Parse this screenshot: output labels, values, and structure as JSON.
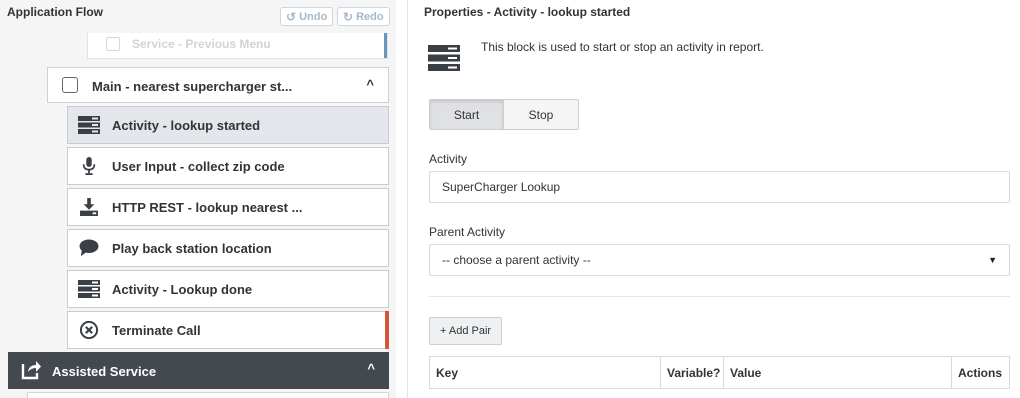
{
  "left_panel": {
    "title": "Application Flow",
    "undo_label": "Undo",
    "redo_label": "Redo",
    "previous_item_label": "Service - Previous Menu",
    "group": {
      "label": "Main - nearest supercharger st..."
    },
    "blocks": [
      {
        "label": "Activity - lookup started",
        "icon": "activity-icon",
        "selected": true
      },
      {
        "label": "User Input - collect zip code",
        "icon": "microphone-icon"
      },
      {
        "label": "HTTP REST - lookup nearest ...",
        "icon": "download-icon"
      },
      {
        "label": "Play back station location",
        "icon": "speech-bubble-icon"
      },
      {
        "label": "Activity - Lookup done",
        "icon": "activity-icon"
      },
      {
        "label": "Terminate Call",
        "icon": "terminate-call-icon"
      }
    ],
    "assisted": {
      "label": "Assisted Service"
    }
  },
  "right_panel": {
    "title": "Properties - Activity - lookup started",
    "description": "This block is used to start or stop an activity in report.",
    "segment": {
      "start_label": "Start",
      "stop_label": "Stop",
      "selected": "Start"
    },
    "activity": {
      "label": "Activity",
      "value": "SuperCharger Lookup"
    },
    "parent_activity": {
      "label": "Parent Activity",
      "selected": "-- choose a parent activity --"
    },
    "add_pair_label": "+ Add Pair",
    "table_headers": {
      "key": "Key",
      "variable": "Variable?",
      "value": "Value",
      "actions": "Actions"
    }
  },
  "colors": {
    "terminate_accent": "#d4553a",
    "assisted_header_bg": "#44484f",
    "selected_row_bg": "#e3e7ec"
  }
}
